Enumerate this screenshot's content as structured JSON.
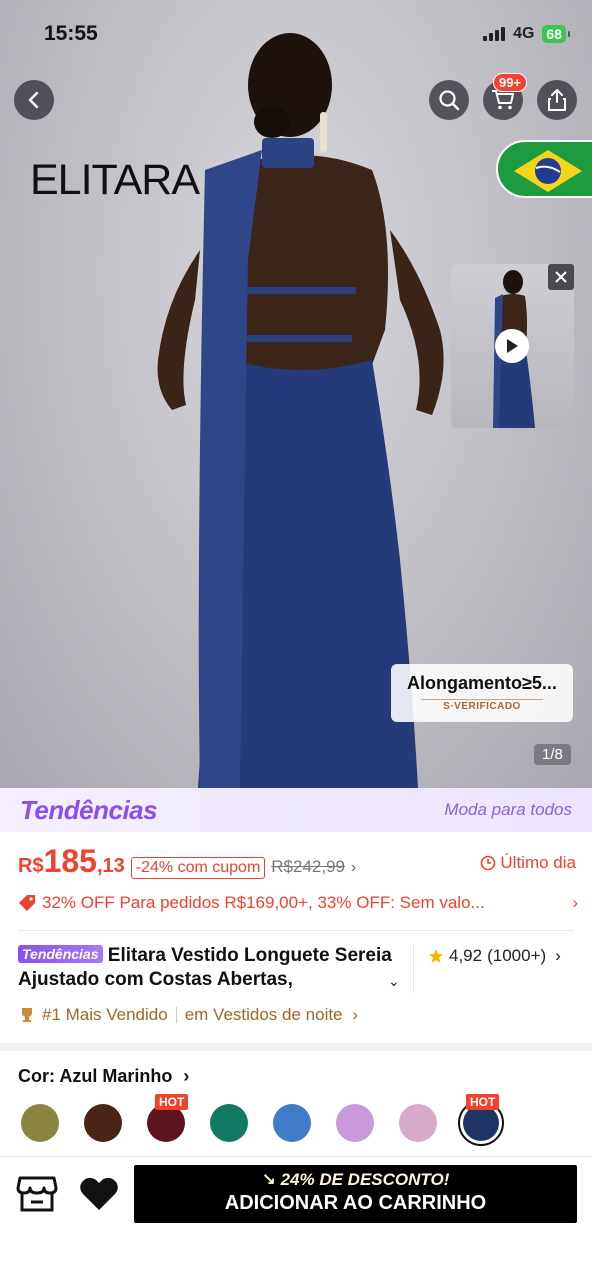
{
  "status_bar": {
    "time": "15:55",
    "network": "4G",
    "battery": "68"
  },
  "nav": {
    "cart_badge": "99+"
  },
  "hero": {
    "brand": "ELITARA",
    "verify_title": "Alongamento≥5...",
    "verify_sub": "S·VERIFICADO",
    "page_indicator": "1/8"
  },
  "trend": {
    "logo": "Tendências",
    "slogan": "Moda para todos"
  },
  "price": {
    "currency": "R$",
    "integer": "185",
    "decimal": ",13",
    "coupon": "-24% com cupom",
    "old_price": "R$242,99",
    "last_day": "Último dia"
  },
  "promo": "32% OFF Para pedidos R$169,00+,  33% OFF: Sem valo...",
  "product": {
    "tag": "Tendências",
    "title": "Elitara Vestido Longuete Sereia Ajustado com Costas Abertas,",
    "rating": "4,92",
    "rating_count": "(1000+)",
    "rank": "#1 Mais Vendido",
    "rank_category": "em Vestidos de noite"
  },
  "color": {
    "label": "Cor: Azul Marinho",
    "swatches": [
      "#8b8440",
      "#4a2416",
      "#5e1320",
      "#127a63",
      "#3f7bc6",
      "#c89adb",
      "#d8a9c8",
      "#1f3466"
    ],
    "hot_label": "HOT"
  },
  "bottom": {
    "discount": "24% DE DESCONTO!",
    "add_to_cart": "ADICIONAR AO CARRINHO"
  }
}
